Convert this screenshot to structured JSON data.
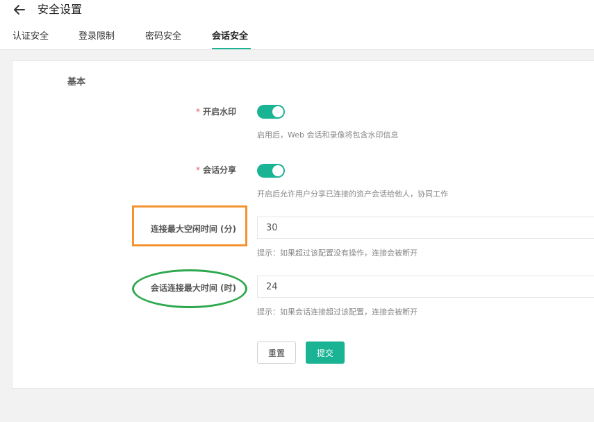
{
  "header": {
    "title": "安全设置",
    "back_icon": "arrow-left-icon"
  },
  "tabs": [
    {
      "label": "认证安全",
      "active": false
    },
    {
      "label": "登录限制",
      "active": false
    },
    {
      "label": "密码安全",
      "active": false
    },
    {
      "label": "会话安全",
      "active": true
    }
  ],
  "section": {
    "title": "基本"
  },
  "form": {
    "required_mark": "*",
    "watermark": {
      "label": "开启水印",
      "enabled": true,
      "help": "启用后，Web 会话和录像将包含水印信息"
    },
    "session_share": {
      "label": "会话分享",
      "enabled": true,
      "help": "开启后允许用户分享已连接的资产会话给他人，协同工作"
    },
    "idle_timeout": {
      "label": "连接最大空闲时间 (分)",
      "value": "30",
      "help": "提示：如果超过该配置没有操作，连接会被断开"
    },
    "max_duration": {
      "label": "会话连接最大时间 (时)",
      "value": "24",
      "help": "提示：如果会话连接超过该配置，连接会被断开"
    }
  },
  "buttons": {
    "reset": "重置",
    "submit": "提交"
  },
  "colors": {
    "accent": "#1ab394",
    "highlight_orange": "#f5922f",
    "highlight_green": "#2ea84e",
    "required": "#ed5565"
  }
}
